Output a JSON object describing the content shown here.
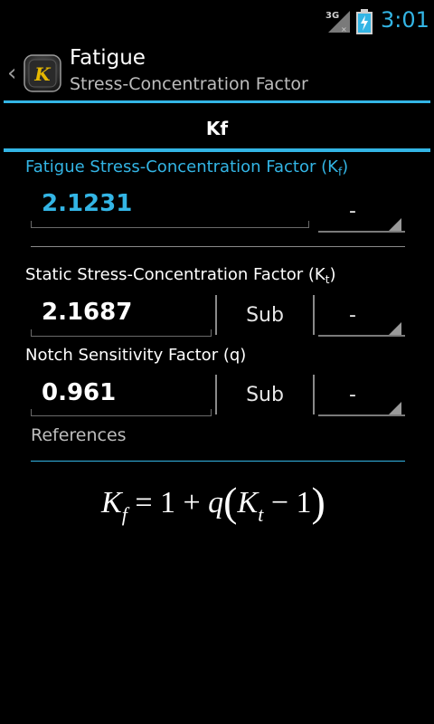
{
  "status_bar": {
    "network": "3G",
    "time": "3:01",
    "accent_color": "#33b5e5"
  },
  "action_bar": {
    "up_icon": "chevron-left-icon",
    "app_icon_letter": "K",
    "title": "Fatigue",
    "subtitle": "Stress-Concentration Factor"
  },
  "tab": {
    "label": "Kf"
  },
  "fatigue_factor": {
    "label_main": "Fatigue Stress-Concentration Factor (K",
    "label_sub": "f",
    "label_close": ")",
    "value": "2.1231",
    "unit": "-"
  },
  "static_factor": {
    "label_main": "Static Stress-Concentration Factor (K",
    "label_sub": "t",
    "label_close": ")",
    "value": "2.1687",
    "button": "Sub",
    "unit": "-"
  },
  "notch_factor": {
    "label": "Notch Sensitivity Factor (q)",
    "value": "0.961",
    "button": "Sub",
    "unit": "-"
  },
  "references": {
    "label": "References"
  },
  "formula": {
    "k": "K",
    "sub_f": "f",
    "eq": " = 1 + ",
    "q": "q",
    "open": "(",
    "k2": "K",
    "sub_t": "t",
    "minus": " − 1",
    "close": ")"
  }
}
